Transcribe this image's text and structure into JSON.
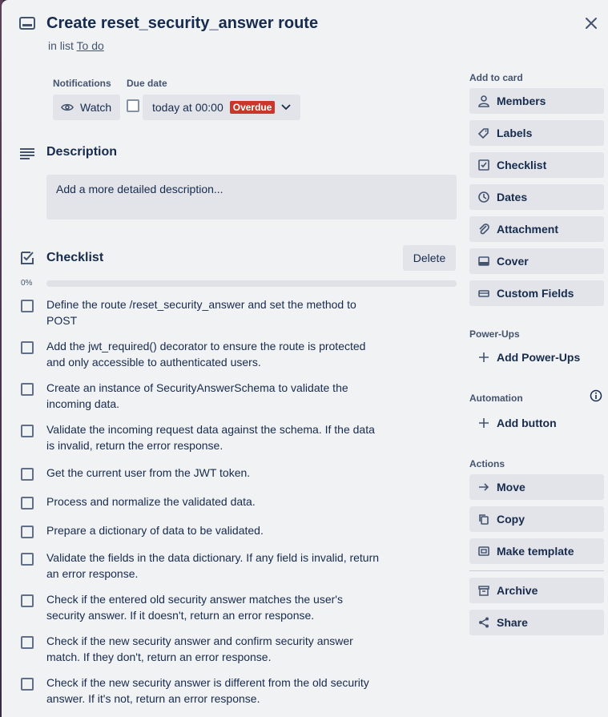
{
  "card": {
    "title": "Create reset_security_answer route",
    "in_list_prefix": "in list",
    "list_name": "To do"
  },
  "notifications": {
    "label": "Notifications",
    "watch_label": "Watch"
  },
  "due": {
    "label": "Due date",
    "value": "today at 00:00",
    "badge": "Overdue"
  },
  "description": {
    "title": "Description",
    "placeholder": "Add a more detailed description..."
  },
  "checklist": {
    "title": "Checklist",
    "delete_label": "Delete",
    "percent_label": "0%",
    "progress": 0,
    "items": [
      "Define the route /reset_security_answer and set the method to POST",
      "Add the jwt_required() decorator to ensure the route is protected and only accessible to authenticated users.",
      "Create an instance of SecurityAnswerSchema to validate the incoming data.",
      "Validate the incoming request data against the schema. If the data is invalid, return the error response.",
      "Get the current user from the JWT token.",
      "Process and normalize the validated data.",
      "Prepare a dictionary of data to be validated.",
      "Validate the fields in the data dictionary. If any field is invalid, return an error response.",
      "Check if the entered old security answer matches the user's security answer. If it doesn't, return an error response.",
      "Check if the new security answer and confirm security answer match. If they don't, return an error response.",
      "Check if the new security answer is different from the old security answer. If it's not, return an error response."
    ]
  },
  "sidebar": {
    "add_to_card": "Add to card",
    "members": "Members",
    "labels": "Labels",
    "checklist": "Checklist",
    "dates": "Dates",
    "attachment": "Attachment",
    "cover": "Cover",
    "custom_fields": "Custom Fields",
    "powerups_label": "Power-Ups",
    "add_powerups": "Add Power-Ups",
    "automation_label": "Automation",
    "add_button": "Add button",
    "actions_label": "Actions",
    "move": "Move",
    "copy": "Copy",
    "make_template": "Make template",
    "archive": "Archive",
    "share": "Share"
  },
  "colors": {
    "overdue": "#c9372c",
    "panel_bg": "#f1f2f4",
    "button_bg": "#e2e4e9"
  }
}
